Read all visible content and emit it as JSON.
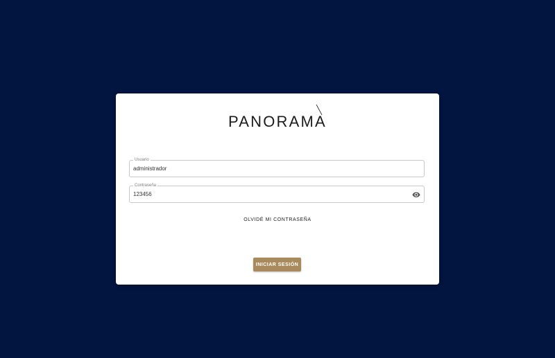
{
  "brand": {
    "logo_text": "PANORAMA"
  },
  "login": {
    "username": {
      "label": "Usuario",
      "value": "administrador"
    },
    "password": {
      "label": "Contraseña",
      "value": "123456",
      "toggle_icon": "eye-icon"
    },
    "forgot_label": "OLVIDÉ MI CONTRASEÑA",
    "submit_label": "INICIAR SESIÓN"
  },
  "colors": {
    "background": "#021541",
    "card": "#ffffff",
    "button": "#a88a5c"
  }
}
